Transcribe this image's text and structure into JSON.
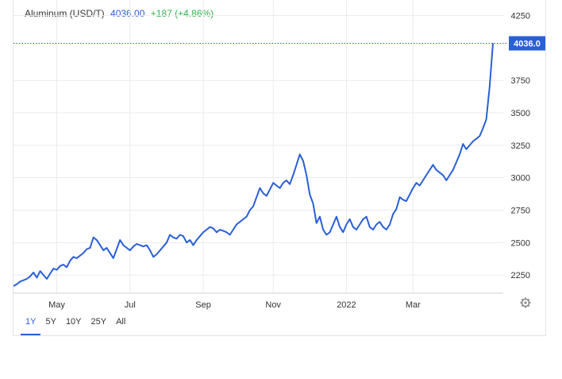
{
  "header": {
    "name": "Aluminum (USD/T)",
    "price": "4036.00",
    "change": "+187 (+4.86%)"
  },
  "range_buttons": [
    {
      "label": "1Y",
      "active": true
    },
    {
      "label": "5Y",
      "active": false
    },
    {
      "label": "10Y",
      "active": false
    },
    {
      "label": "25Y",
      "active": false
    },
    {
      "label": "All",
      "active": false
    }
  ],
  "settings_icon": "gear-icon",
  "colors": {
    "line": "#2a5fd6",
    "change": "#2db14a",
    "badge": "#2a5fd6"
  },
  "chart_data": {
    "type": "line",
    "series": [
      {
        "values": [
          2165,
          2180,
          2200,
          2210,
          2220,
          2240,
          2270,
          2230,
          2280,
          2250,
          2220,
          2260,
          2300,
          2290,
          2320,
          2330,
          2310,
          2360,
          2390,
          2380,
          2400,
          2420,
          2450,
          2460,
          2540,
          2520,
          2480,
          2440,
          2460,
          2420,
          2380,
          2450,
          2520,
          2480,
          2460,
          2440,
          2470,
          2490,
          2480,
          2470,
          2480,
          2440,
          2390,
          2410,
          2440,
          2470,
          2500,
          2560,
          2540,
          2530,
          2560,
          2550,
          2500,
          2520,
          2480,
          2520,
          2550,
          2580,
          2600,
          2620,
          2610,
          2580,
          2600,
          2590,
          2580,
          2560,
          2600,
          2640,
          2660,
          2680,
          2700,
          2750,
          2780,
          2850,
          2920,
          2880,
          2860,
          2910,
          2960,
          2940,
          2920,
          2960,
          2980,
          2950,
          3020,
          3100,
          3180,
          3130,
          3020,
          2870,
          2800,
          2650,
          2700,
          2600,
          2560,
          2580,
          2640,
          2700,
          2620,
          2580,
          2640,
          2680,
          2620,
          2600,
          2640,
          2680,
          2700,
          2620,
          2600,
          2640,
          2660,
          2620,
          2600,
          2640,
          2720,
          2760,
          2850,
          2830,
          2820,
          2870,
          2920,
          2960,
          2940,
          2980,
          3020,
          3060,
          3100,
          3060,
          3040,
          3020,
          2980,
          3020,
          3060,
          3120,
          3180,
          3260,
          3220,
          3250,
          3280,
          3300,
          3320,
          3380,
          3450,
          3700,
          4036
        ]
      }
    ],
    "x_labels": [
      "May",
      "Jul",
      "Sep",
      "Nov",
      "2022",
      "Mar"
    ],
    "x_label_index": [
      13,
      35,
      57,
      78,
      100,
      120
    ],
    "yticks": [
      2250,
      2500,
      2750,
      3000,
      3250,
      3500,
      3750,
      4250
    ],
    "ylim": [
      2110,
      4370
    ],
    "last_value_label": "4036.0",
    "last_value": 4036.0,
    "grid": true,
    "legend": "none"
  }
}
